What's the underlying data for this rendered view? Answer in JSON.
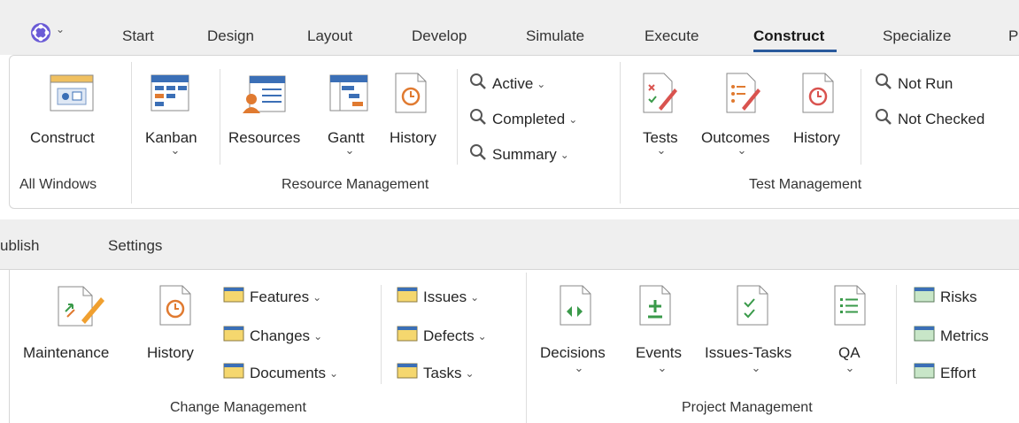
{
  "top": {
    "tabs": [
      "Start",
      "Design",
      "Layout",
      "Develop",
      "Simulate",
      "Execute",
      "Construct",
      "Specialize",
      "P"
    ],
    "active_tab": "Construct",
    "all_windows": {
      "construct_label": "Construct",
      "group": "All Windows"
    },
    "resource": {
      "kanban": "Kanban",
      "resources": "Resources",
      "gantt": "Gantt",
      "history": "History",
      "active": "Active",
      "completed": "Completed",
      "summary": "Summary",
      "group": "Resource Management"
    },
    "test": {
      "tests": "Tests",
      "outcomes": "Outcomes",
      "history": "History",
      "not_run": "Not Run",
      "not_checked": "Not Checked",
      "group": "Test Management"
    }
  },
  "bottom": {
    "tabs": [
      "ublish",
      "Settings"
    ],
    "change": {
      "maintenance": "Maintenance",
      "history": "History",
      "features": "Features",
      "changes": "Changes",
      "documents": "Documents",
      "issues": "Issues",
      "defects": "Defects",
      "tasks": "Tasks",
      "group": "Change Management"
    },
    "project": {
      "decisions": "Decisions",
      "events": "Events",
      "issues_tasks": "Issues-Tasks",
      "qa": "QA",
      "risks": "Risks",
      "metrics": "Metrics",
      "effort": "Effort",
      "group": "Project Management"
    }
  },
  "chevron_glyph": "⌄",
  "colors": {
    "accent": "#2a5a9c",
    "folder": "#f5d76e",
    "icon_blue": "#3b6fb6",
    "icon_orange": "#e07a30",
    "icon_green": "#3a9a4a"
  }
}
